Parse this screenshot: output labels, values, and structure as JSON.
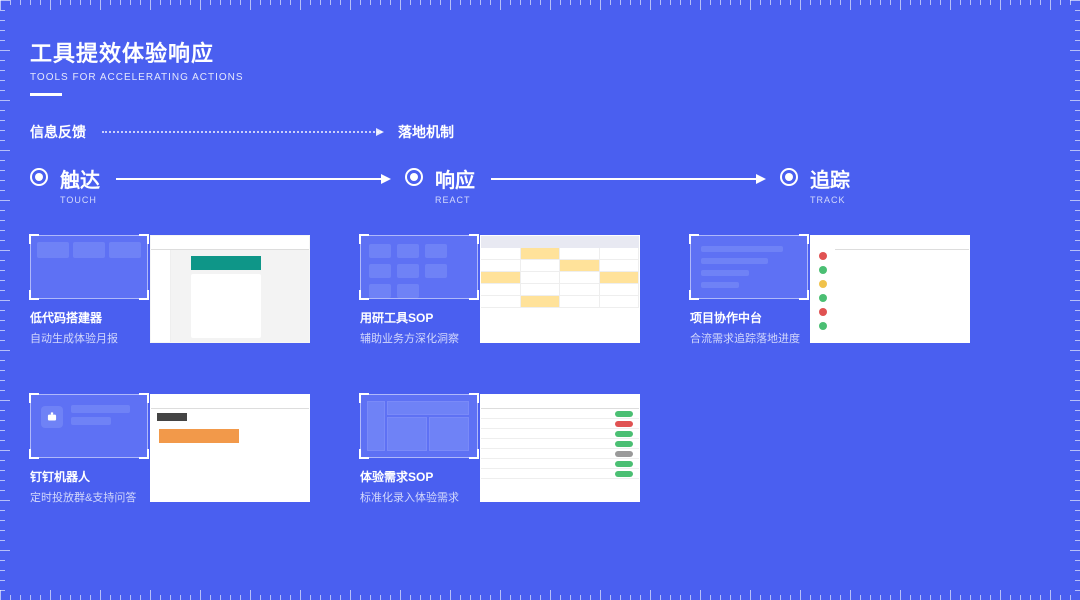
{
  "title": {
    "main": "工具提效体验响应",
    "sub": "TOOLS FOR ACCELERATING ACTIONS"
  },
  "flow": {
    "from": "信息反馈",
    "to": "落地机制"
  },
  "stages": {
    "touch": {
      "cn": "触达",
      "en": "TOUCH"
    },
    "react": {
      "cn": "响应",
      "en": "REACT"
    },
    "track": {
      "cn": "追踪",
      "en": "TRACK"
    }
  },
  "cards": {
    "lowcode": {
      "title": "低代码搭建器",
      "desc": "自动生成体验月报"
    },
    "dingbot": {
      "title": "钉钉机器人",
      "desc": "定时投放群&支持问答"
    },
    "research_sop": {
      "title": "用研工具SOP",
      "desc": "辅助业务方深化洞察"
    },
    "demand_sop": {
      "title": "体验需求SOP",
      "desc": "标准化录入体验需求"
    },
    "project_mid": {
      "title": "项目协作中台",
      "desc": "合流需求追踪落地进度"
    }
  }
}
